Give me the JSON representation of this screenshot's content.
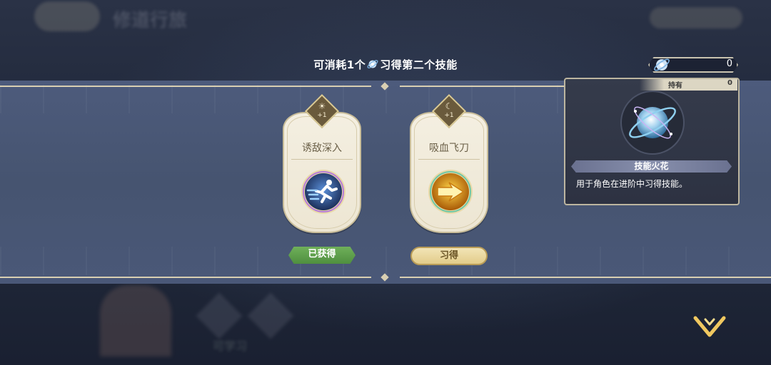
{
  "background": {
    "title": "修道行旅",
    "caption": "可学习"
  },
  "headline": {
    "before": "可消耗1个",
    "after": "习得第二个技能",
    "icon": "skill-spark-icon"
  },
  "cards": [
    {
      "name": "诱敌深入",
      "badge": "+1",
      "badge_icon": "sun-icon",
      "icon": "running-figure-icon",
      "button": "已获得",
      "button_state": "owned"
    },
    {
      "name": "吸血飞刀",
      "badge": "+1",
      "badge_icon": "moon-icon",
      "icon": "arrow-dash-icon",
      "button": "习得",
      "button_state": "learn"
    }
  ],
  "counter": {
    "icon": "skill-spark-icon",
    "value": "0"
  },
  "tooltip": {
    "hold_label": "持有",
    "hold_value": "0",
    "item_icon": "skill-spark-orb-icon",
    "name": "技能火花",
    "description": "用于角色在进阶中习得技能。"
  },
  "colors": {
    "band": "#4a5878",
    "owned_green": "#5fa04b",
    "learn_gold": "#e8d49a",
    "card": "#f1ebdc"
  },
  "continue_icon": "chevron-down-icon"
}
